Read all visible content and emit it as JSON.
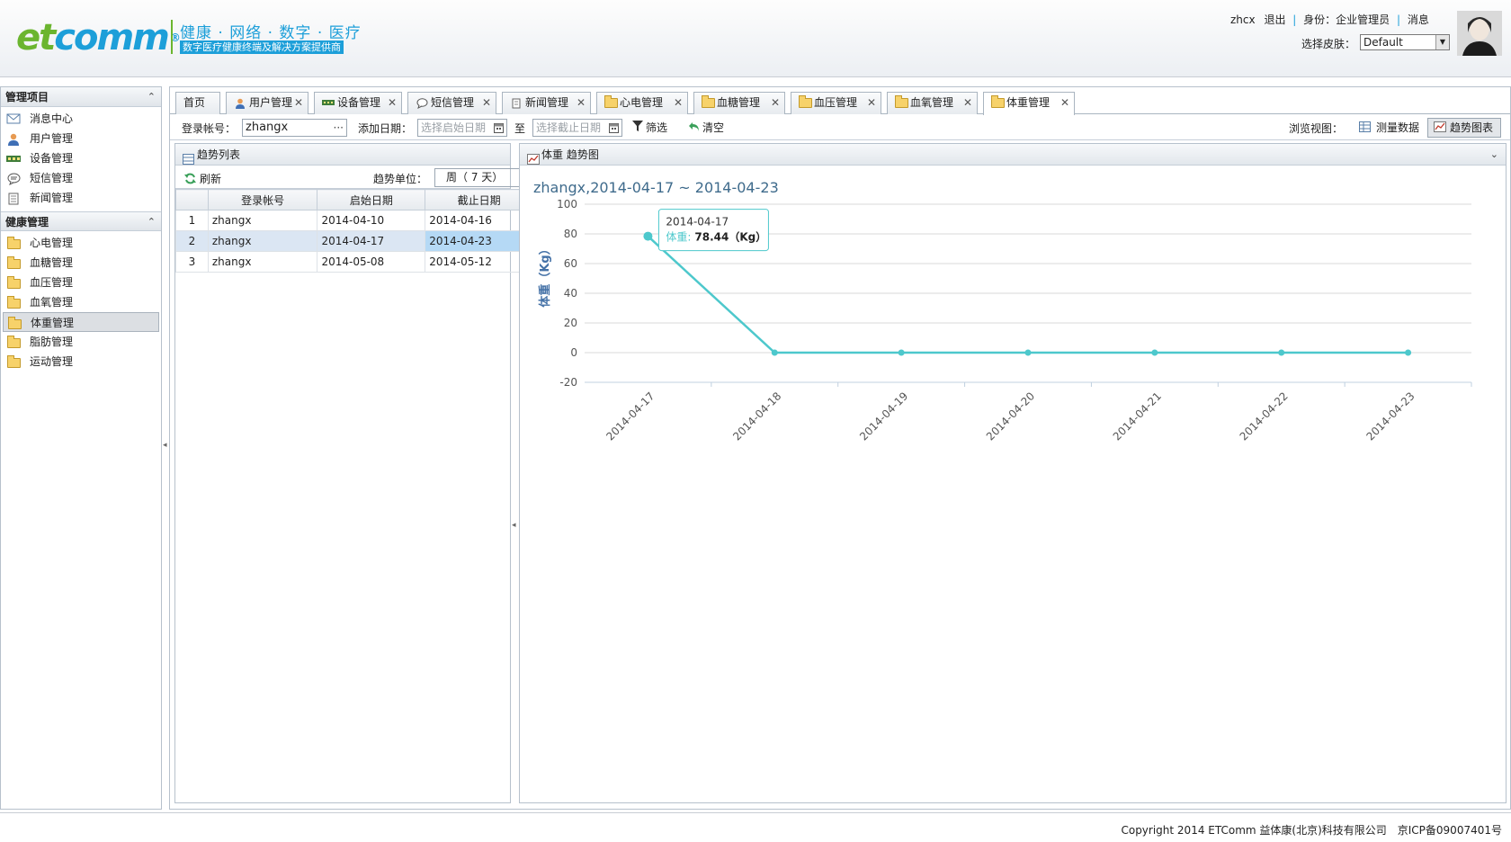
{
  "header": {
    "logo_e": "et",
    "logo_comm": "comm",
    "logo_reg": "®",
    "slogan": "健康 · 网络 · 数字 · 医疗",
    "subslogan": "数字医疗健康终端及解决方案提供商",
    "username": "zhcx",
    "logout": "退出",
    "identity": "身份：企业管理员",
    "messages": "消息",
    "skin_label": "选择皮肤：",
    "skin_value": "Default"
  },
  "sidebar": {
    "section1_title": "管理项目",
    "section1_items": [
      {
        "label": "消息中心",
        "icon": "envelope-icon"
      },
      {
        "label": "用户管理",
        "icon": "user-icon"
      },
      {
        "label": "设备管理",
        "icon": "device-icon"
      },
      {
        "label": "短信管理",
        "icon": "sms-icon"
      },
      {
        "label": "新闻管理",
        "icon": "news-icon"
      }
    ],
    "section2_title": "健康管理",
    "section2_items": [
      {
        "label": "心电管理"
      },
      {
        "label": "血糖管理"
      },
      {
        "label": "血压管理"
      },
      {
        "label": "血氧管理"
      },
      {
        "label": "体重管理",
        "active": true
      },
      {
        "label": "脂肪管理"
      },
      {
        "label": "运动管理"
      }
    ]
  },
  "tabs": [
    {
      "label": "首页"
    },
    {
      "label": "用户管理",
      "close": "✕"
    },
    {
      "label": "设备管理",
      "close": "✕"
    },
    {
      "label": "短信管理",
      "close": "✕"
    },
    {
      "label": "新闻管理",
      "close": "✕"
    },
    {
      "label": "心电管理",
      "close": "✕"
    },
    {
      "label": "血糖管理",
      "close": "✕"
    },
    {
      "label": "血压管理",
      "close": "✕"
    },
    {
      "label": "血氧管理",
      "close": "✕"
    },
    {
      "label": "体重管理",
      "close": "✕",
      "active": true
    }
  ],
  "toolbar": {
    "account_label": "登录帐号：",
    "account_value": "zhangx",
    "date_label": "添加日期：",
    "start_placeholder": "选择启始日期",
    "to_label": "至",
    "end_placeholder": "选择截止日期",
    "filter_label": "筛选",
    "clear_label": "清空",
    "view_label": "浏览视图：",
    "view_grid": "测量数据",
    "view_chart": "趋势图表"
  },
  "trend_list": {
    "title": "趋势列表",
    "refresh": "刷新",
    "unit_label": "趋势单位：",
    "unit_value": "周（ 7 天）",
    "columns": [
      "登录帐号",
      "启始日期",
      "截止日期"
    ],
    "rows": [
      {
        "n": "1",
        "account": "zhangx",
        "start": "2014-04-10",
        "end": "2014-04-16"
      },
      {
        "n": "2",
        "account": "zhangx",
        "start": "2014-04-17",
        "end": "2014-04-23",
        "selected": true
      },
      {
        "n": "3",
        "account": "zhangx",
        "start": "2014-05-08",
        "end": "2014-05-12"
      }
    ]
  },
  "chart_panel": {
    "title": "体重 趋势图"
  },
  "chart_data": {
    "type": "line",
    "title": "zhangx,2014-04-17 ~ 2014-04-23",
    "ylabel": "体重（Kg）",
    "xlabel": "",
    "x": [
      "2014-04-17",
      "2014-04-18",
      "2014-04-19",
      "2014-04-20",
      "2014-04-21",
      "2014-04-22",
      "2014-04-23"
    ],
    "series": [
      {
        "name": "体重",
        "values": [
          78.44,
          0,
          0,
          0,
          0,
          0,
          0
        ]
      }
    ],
    "ylim": [
      -20,
      100
    ],
    "yticks": [
      -20,
      0,
      20,
      40,
      60,
      80,
      100
    ],
    "grid": true,
    "color": "#4dc8cc",
    "tooltip": {
      "date": "2014-04-17",
      "series": "体重:",
      "value": "78.44（Kg）"
    }
  },
  "footer": {
    "copyright": "Copyright 2014 ETComm 益体康(北京)科技有限公司　京ICP备09007401号"
  }
}
